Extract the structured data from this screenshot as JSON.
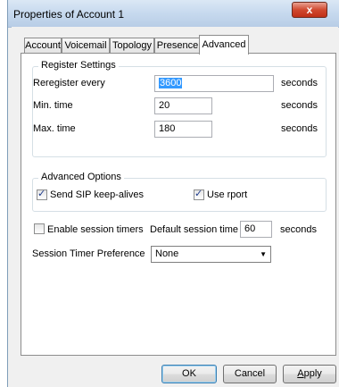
{
  "window": {
    "title": "Properties of Account 1",
    "close_glyph": "x"
  },
  "tabs": [
    {
      "label": "Account",
      "active": false
    },
    {
      "label": "Voicemail",
      "active": false
    },
    {
      "label": "Topology",
      "active": false
    },
    {
      "label": "Presence",
      "active": false
    },
    {
      "label": "Advanced",
      "active": true
    }
  ],
  "register_settings": {
    "title": "Register Settings",
    "reregister_label": "Reregister every",
    "reregister_value": "3600",
    "reregister_unit": "seconds",
    "min_label": "Min. time",
    "min_value": "20",
    "min_unit": "seconds",
    "max_label": "Max. time",
    "max_value": "180",
    "max_unit": "seconds"
  },
  "advanced_options": {
    "title": "Advanced Options",
    "keepalive_label": "Send SIP keep-alives",
    "keepalive_checked": true,
    "rport_label": "Use rport",
    "rport_checked": true
  },
  "session": {
    "enable_timers_label": "Enable session timers",
    "enable_timers_checked": false,
    "default_time_label": "Default session time",
    "default_time_value": "60",
    "default_time_unit": "seconds",
    "preference_label": "Session Timer Preference",
    "preference_value": "None"
  },
  "buttons": {
    "ok": "OK",
    "cancel": "Cancel",
    "apply_first": "A",
    "apply_rest": "pply"
  },
  "glyphs": {
    "check": "✓",
    "dropdown": "▼"
  }
}
